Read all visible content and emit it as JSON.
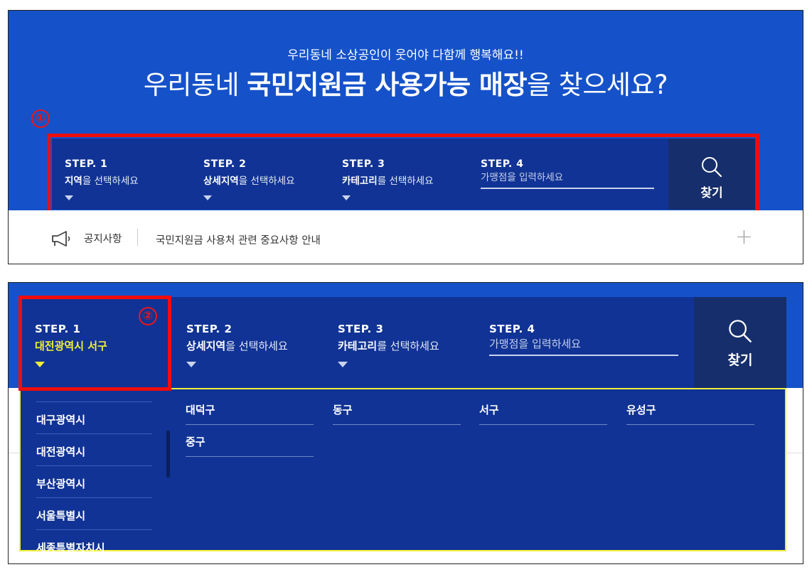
{
  "panel1": {
    "marker": "①",
    "subtitle": "우리동네 소상공인이 웃어야 다함께 행복해요!!",
    "title": {
      "part1": "우리동네 ",
      "part2": "국민지원금 사용가능 매장",
      "part3": "을 찾으세요?"
    },
    "steps": [
      {
        "title": "STEP. 1",
        "bold": "지역",
        "rest": "을 선택하세요"
      },
      {
        "title": "STEP. 2",
        "bold": "상세지역",
        "rest": "을 선택하세요"
      },
      {
        "title": "STEP. 3",
        "bold": "카테고리",
        "rest": "를 선택하세요"
      }
    ],
    "step4": {
      "title": "STEP. 4",
      "placeholder": "가맹점을 입력하세요"
    },
    "find_label": "찾기",
    "notice": {
      "label": "공지사항",
      "text": "국민지원금 사용처 관련 중요사항 안내",
      "expand": "+"
    }
  },
  "panel2": {
    "marker": "②",
    "step1": {
      "title": "STEP. 1",
      "selected": "대전광역시 서구"
    },
    "steps": [
      {
        "title": "STEP. 2",
        "bold": "상세지역",
        "rest": "을 선택하세요"
      },
      {
        "title": "STEP. 3",
        "bold": "카테고리",
        "rest": "를 선택하세요"
      }
    ],
    "step4": {
      "title": "STEP. 4",
      "placeholder": "가맹점을 입력하세요"
    },
    "find_label": "찾기",
    "regions": [
      "대구광역시",
      "대전광역시",
      "부산광역시",
      "서울특별시",
      "세종특별자치시"
    ],
    "districts": [
      "대덕구",
      "동구",
      "서구",
      "유성구",
      "중구"
    ]
  },
  "colors": {
    "hero_blue": "#1552c9",
    "bar_navy": "#113395",
    "button_navy": "#162e6b",
    "highlight_red": "#ef0d0d",
    "selected_yellow": "#f0f03a"
  },
  "icons": [
    "search-icon",
    "megaphone-icon",
    "plus-icon",
    "chevron-down-icon"
  ]
}
